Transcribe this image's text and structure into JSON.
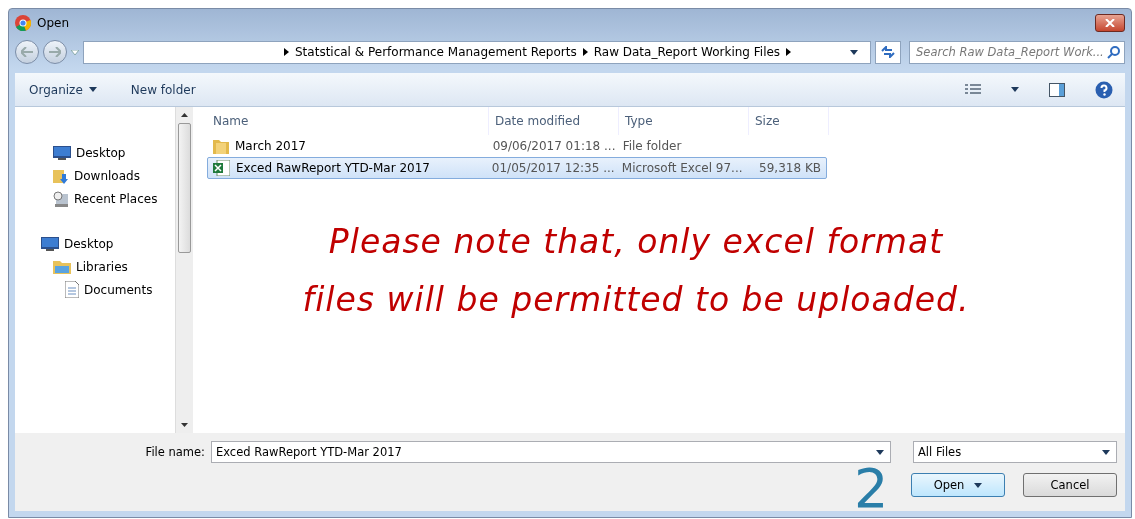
{
  "window": {
    "title": "Open"
  },
  "address": {
    "crumbs": [
      "Statstical & Performance Management Reports",
      "Raw Data_Report Working Files"
    ]
  },
  "search": {
    "placeholder": "Search Raw Data_Report Work..."
  },
  "toolbar": {
    "organize": "Organize",
    "new_folder": "New folder"
  },
  "sidebar": {
    "favorites": [
      {
        "label": "Desktop",
        "kind": "desktop"
      },
      {
        "label": "Downloads",
        "kind": "downloads"
      },
      {
        "label": "Recent Places",
        "kind": "recent"
      }
    ],
    "tree": [
      {
        "label": "Desktop",
        "kind": "desktop",
        "children": [
          {
            "label": "Libraries",
            "kind": "libraries",
            "children": [
              {
                "label": "Documents",
                "kind": "document"
              }
            ]
          }
        ]
      }
    ]
  },
  "table": {
    "columns": [
      "Name",
      "Date modified",
      "Type",
      "Size"
    ],
    "rows": [
      {
        "kind": "folder",
        "name": "March 2017",
        "date": "09/06/2017 01:18 ...",
        "type": "File folder",
        "size": "",
        "selected": false
      },
      {
        "kind": "excel",
        "name": "Exced RawReport YTD-Mar 2017",
        "date": "01/05/2017 12:35 ...",
        "type": "Microsoft Excel 97...",
        "size": "59,318 KB",
        "selected": true
      }
    ]
  },
  "note": [
    "Please note that, only excel format",
    "files will be permitted to be uploaded."
  ],
  "footer": {
    "file_name_label": "File name:",
    "file_name": "Exced RawReport YTD-Mar 2017",
    "filter": "All Files",
    "open": "Open",
    "cancel": "Cancel"
  },
  "annotation": "2"
}
